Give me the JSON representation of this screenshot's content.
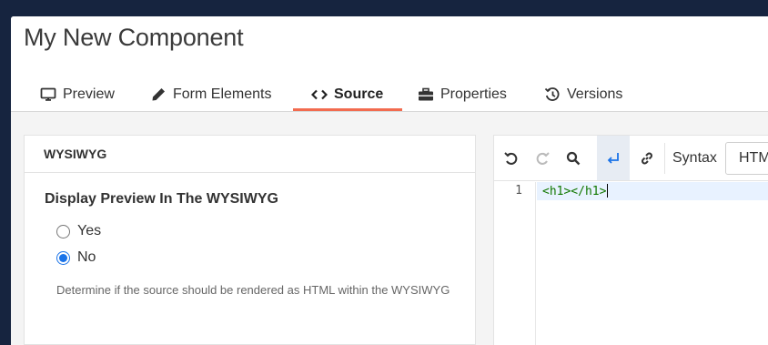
{
  "page": {
    "title": "My New Component"
  },
  "tabs": [
    {
      "label": "Preview",
      "icon": "monitor-icon",
      "active": false
    },
    {
      "label": "Form Elements",
      "icon": "pencil-icon",
      "active": false
    },
    {
      "label": "Source",
      "icon": "code-icon",
      "active": true
    },
    {
      "label": "Properties",
      "icon": "toolbox-icon",
      "active": false
    },
    {
      "label": "Versions",
      "icon": "history-icon",
      "active": false
    }
  ],
  "panel": {
    "heading": "WYSIWYG",
    "field_label": "Display Preview In The WYSIWYG",
    "options": [
      {
        "label": "Yes",
        "checked": false
      },
      {
        "label": "No",
        "checked": true
      }
    ],
    "help_text": "Determine if the source should be rendered as HTML within the WYSIWYG"
  },
  "editor": {
    "toolbar": {
      "buttons": [
        "undo-icon",
        "redo-icon",
        "search-icon",
        "wrap-icon",
        "link-icon"
      ],
      "syntax_label": "Syntax",
      "syntax_value": "HTML"
    },
    "lines": [
      {
        "number": "1",
        "code": "<h1></h1>"
      }
    ]
  },
  "colors": {
    "accent_underline": "#f26b4f",
    "radio_selected": "#1a73e8",
    "code_text": "#117700",
    "active_line": "#e8f2ff"
  }
}
